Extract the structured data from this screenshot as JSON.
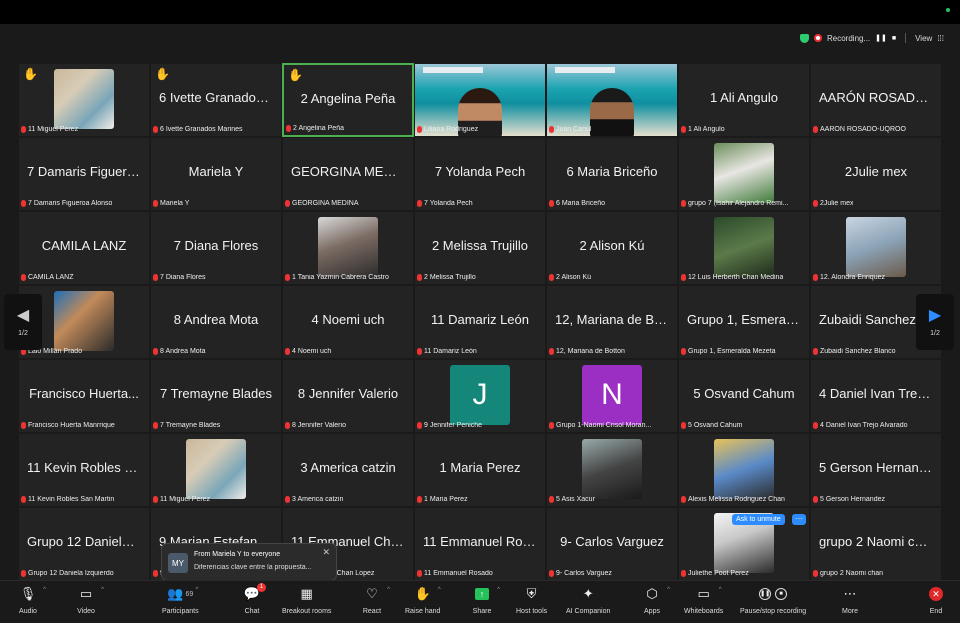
{
  "recording": {
    "status": "Recording...",
    "pause": "❚❚",
    "stop": "■",
    "view": "View"
  },
  "tiles": [
    {
      "name": "",
      "label": "11 Miguel Perez",
      "hand": true,
      "avatar": "photo1"
    },
    {
      "name": "6 Ivette Granados...",
      "label": "6 Ivette Granados Marines",
      "hand": true
    },
    {
      "name": "2 Angelina Peña",
      "label": "2 Angelina Peña",
      "hand": true,
      "active": true
    },
    {
      "name": "",
      "label": "Liliana Rodriguez",
      "video": "p1"
    },
    {
      "name": "",
      "label": "Juan Canul",
      "video": "p2"
    },
    {
      "name": "1 Ali Angulo",
      "label": "1 Ali Angulo"
    },
    {
      "name": "AARÓN ROSADO-...",
      "label": "AARÓN ROSADO-UQROO"
    },
    {
      "name": "7 Damaris Figuero...",
      "label": "7 Damaris Figueroa Alonso"
    },
    {
      "name": "Mariela Y",
      "label": "Mariela Y"
    },
    {
      "name": "GEORGINA MEDINA",
      "label": "GEORGINA MEDINA"
    },
    {
      "name": "7 Yolanda Pech",
      "label": "7 Yolanda Pech"
    },
    {
      "name": "6 Maria Briceño",
      "label": "6 Maria Briceño"
    },
    {
      "name": "",
      "label": "grupo 7 (Isahir Alejandro Remi...",
      "avatar": "photo2"
    },
    {
      "name": "2Julie mex",
      "label": "2Julie mex"
    },
    {
      "name": "CAMILA LANZ",
      "label": "CAMILA LANZ"
    },
    {
      "name": "7 Diana Flores",
      "label": "7 Diana Flores"
    },
    {
      "name": "",
      "label": "1 Tania Yazmin Cabrera Castro",
      "avatar": "photo3"
    },
    {
      "name": "2 Melissa Trujillo",
      "label": "2 Melissa Trujillo"
    },
    {
      "name": "2 Alison Kú",
      "label": "2 Alison Kú"
    },
    {
      "name": "",
      "label": "12 Luis Herberth Chan Medina",
      "avatar": "photo4"
    },
    {
      "name": "",
      "label": "12. Alondra Enriquez",
      "avatar": "photo5"
    },
    {
      "name": "",
      "label": "Lalo Millán Prado",
      "avatar": "photo6"
    },
    {
      "name": "8 Andrea Mota",
      "label": "8 Andrea Mota"
    },
    {
      "name": "4 Noemi uch",
      "label": "4 Noemi uch"
    },
    {
      "name": "11 Damariz León",
      "label": "11 Damariz León"
    },
    {
      "name": "12, Mariana de Bot...",
      "label": "12, Mariana de Botton"
    },
    {
      "name": "Grupo 1, Esmerald...",
      "label": "Grupo 1, Esmeralda Mezeta"
    },
    {
      "name": "Zubaidi Sanchez B...",
      "label": "Zubaidi Sanchez Blanco"
    },
    {
      "name": "Francisco Huerta...",
      "label": "Francisco Huerta Manrrique"
    },
    {
      "name": "7 Tremayne Blades",
      "label": "7 Tremayne Blades"
    },
    {
      "name": "8 Jennifer Valerio",
      "label": "8 Jennifer Valerio"
    },
    {
      "name": "",
      "label": "9 Jennifer Peniche",
      "letter": "J",
      "color": "#14867a"
    },
    {
      "name": "",
      "label": "Grupo 1-Naomi Crisol Moran...",
      "letter": "N",
      "color": "#9b2fc4"
    },
    {
      "name": "5 Osvand Cahum",
      "label": "5 Osvand Cahum"
    },
    {
      "name": "4 Daniel Ivan Trejo...",
      "label": "4 Daniel Ivan Trejo Alvarado"
    },
    {
      "name": "11 Kevin Robles Sa...",
      "label": "11 Kevin Robles San Martin"
    },
    {
      "name": "",
      "label": "11 Miguel Perez",
      "avatar": "photo1"
    },
    {
      "name": "3 America catzin",
      "label": "3 America catzin"
    },
    {
      "name": "1 Maria Perez",
      "label": "1 Maria Perez"
    },
    {
      "name": "",
      "label": "5 Asis Xacur",
      "avatar": "photo7"
    },
    {
      "name": "",
      "label": "Alexis Melissa Rodriguez Chan",
      "avatar": "photo8"
    },
    {
      "name": "5 Gerson Hernandez",
      "label": "5 Gerson Hernandez"
    },
    {
      "name": "Grupo 12 Daniela I...",
      "label": "Grupo 12 Daniela Izquierdo"
    },
    {
      "name": "9 Marian Estefania...",
      "label": "9 Marian Estefania..."
    },
    {
      "name": "11 Emmanuel Chan L...",
      "label": "11 Emmanuel Chan Lopez"
    },
    {
      "name": "11 Emmanuel Rosa...",
      "label": "11 Emmanuel Rosado"
    },
    {
      "name": "9- Carlos Varguez",
      "label": "9- Carlos Varguez"
    },
    {
      "name": "",
      "label": "Juliethe Poot Perez",
      "avatar": "photo9"
    },
    {
      "name": "grupo 2 Naomi chan",
      "label": "grupo 2 Naomi chan"
    }
  ],
  "ask_to_unmute": "Ask to unmute",
  "ask_more": "···",
  "pager": {
    "prev_label": "1/2",
    "next_label": "1/2"
  },
  "chat_toast": {
    "initials": "MY",
    "from": "From Mariela Y to everyone",
    "message": "Diferencias clave entre la propuesta..."
  },
  "toolbar": {
    "audio": "Audio",
    "video": "Video",
    "participants": "Participants",
    "participants_count": "69",
    "chat": "Chat",
    "chat_badge": "1",
    "breakout": "Breakout rooms",
    "react": "React",
    "raise_hand": "Raise hand",
    "share": "Share",
    "host_tools": "Host tools",
    "ai_companion": "AI Companion",
    "apps": "Apps",
    "whiteboards": "Whiteboards",
    "pause_stop": "Pause/stop recording",
    "more": "More",
    "end": "End"
  }
}
